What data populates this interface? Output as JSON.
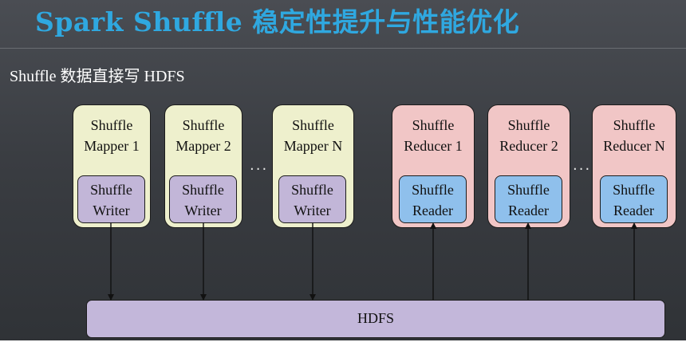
{
  "title": "Spark Shuffle 稳定性提升与性能优化",
  "subtitle": "Shuffle 数据直接写 HDFS",
  "mappers": [
    {
      "label": "Shuffle\nMapper 1",
      "inner": "Shuffle\nWriter"
    },
    {
      "label": "Shuffle\nMapper 2",
      "inner": "Shuffle\nWriter"
    },
    {
      "label": "Shuffle\nMapper N",
      "inner": "Shuffle\nWriter"
    }
  ],
  "reducers": [
    {
      "label": "Shuffle\nReducer 1",
      "inner": "Shuffle\nReader"
    },
    {
      "label": "Shuffle\nReducer 2",
      "inner": "Shuffle\nReader"
    },
    {
      "label": "Shuffle\nReducer N",
      "inner": "Shuffle\nReader"
    }
  ],
  "ellipsis": "...",
  "hdfs_label": "HDFS",
  "colors": {
    "title": "#2fa8e0",
    "mapper_bg": "#eef0cd",
    "reducer_bg": "#f1c6c6",
    "writer_bg": "#c2b6d8",
    "reader_bg": "#8fc0ec",
    "hdfs_bg": "#c3b7da"
  }
}
